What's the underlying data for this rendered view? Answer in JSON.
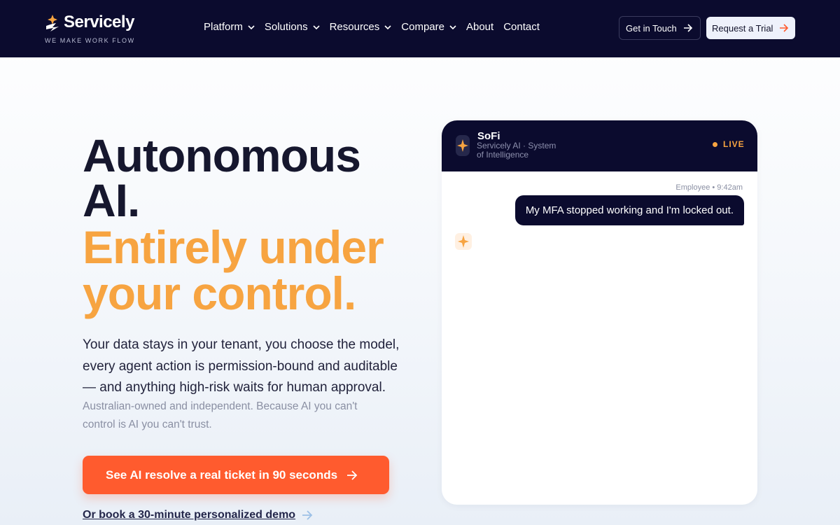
{
  "brand": {
    "name": "Servicely",
    "tagline": "WE MAKE WORK FLOW"
  },
  "nav": {
    "items": [
      {
        "label": "Platform",
        "has_dropdown": true
      },
      {
        "label": "Solutions",
        "has_dropdown": true
      },
      {
        "label": "Resources",
        "has_dropdown": true
      },
      {
        "label": "Compare",
        "has_dropdown": true
      },
      {
        "label": "About",
        "has_dropdown": false
      },
      {
        "label": "Contact",
        "has_dropdown": false
      }
    ],
    "get_in_touch": "Get in Touch",
    "request_trial": "Request a Trial"
  },
  "hero": {
    "line1": "Autonomous",
    "line2": "AI.",
    "line3": "Entirely under",
    "line4": "your control.",
    "lead": "Your data stays in your tenant, you choose the model, every agent action is permission-bound and auditable — and anything high-risk waits for human approval.",
    "sub": "Australian-owned and independent. Because AI you can't control is AI you can't trust.",
    "cta": "See AI resolve a real ticket in 90 seconds",
    "demo_link": "Or book a 30-minute personalized demo"
  },
  "chat": {
    "bot_name": "SoFi",
    "bot_desc": "Servicely AI · System of Intelligence",
    "status": "LIVE",
    "messages": [
      {
        "meta": "Employee • 9:42am",
        "text": "My MFA stopped working and I'm locked out."
      }
    ]
  },
  "colors": {
    "navy": "#0b0b2e",
    "accent_orange": "#f7a441",
    "cta_orange": "#ff5b2e"
  },
  "icons": {
    "logo": "spark-bolt-icon",
    "dropdown": "chevron-down-icon",
    "arrow": "arrow-right-icon",
    "bot": "sparkle-icon"
  }
}
